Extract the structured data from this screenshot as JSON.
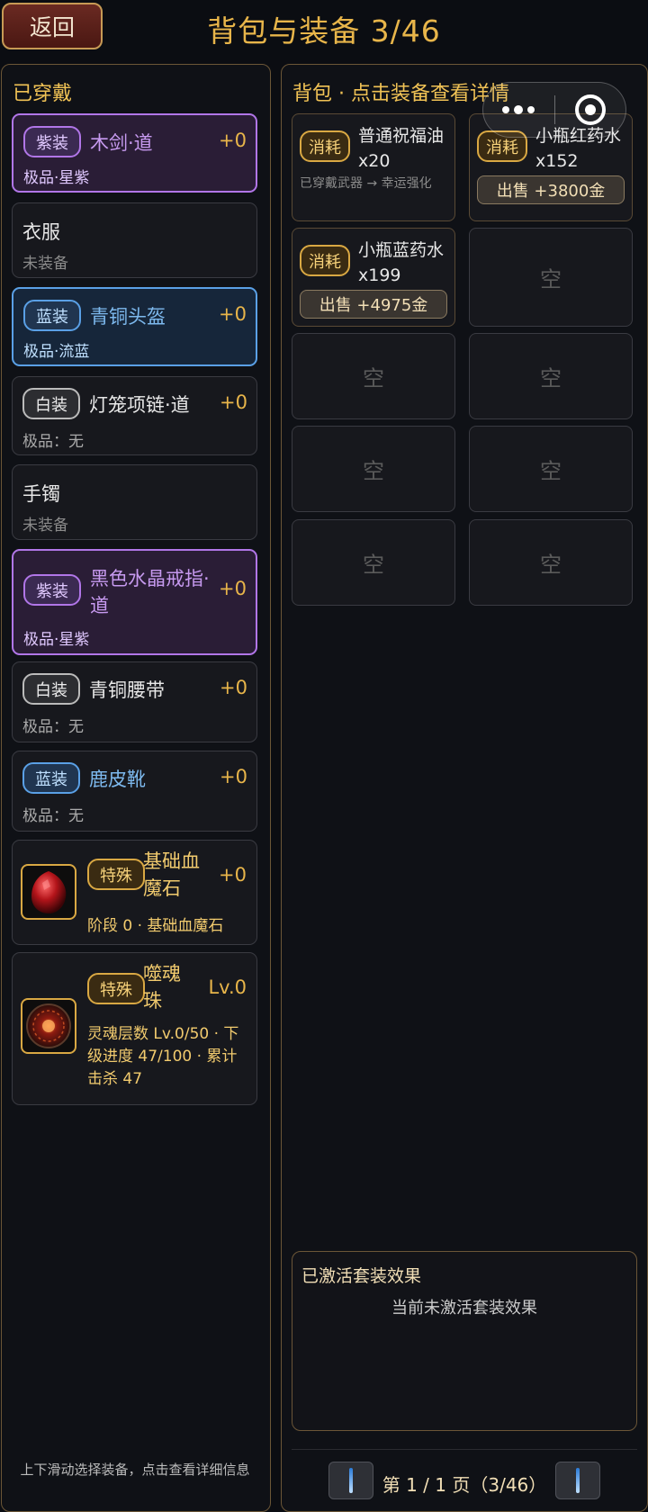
{
  "header": {
    "back_label": "返回",
    "title": "背包与装备 3/46"
  },
  "equipped": {
    "title": "已穿戴",
    "items": [
      {
        "tag": "紫装",
        "name": "木剑·道",
        "plus": "+0",
        "sub": "极品·星紫"
      },
      {
        "name": "衣服",
        "sub": "未装备"
      },
      {
        "tag": "蓝装",
        "name": "青铜头盔",
        "plus": "+0",
        "sub": "极品·流蓝"
      },
      {
        "tag": "白装",
        "name": "灯笼项链·道",
        "plus": "+0",
        "sub": "极品：无"
      },
      {
        "name": "手镯",
        "sub": "未装备"
      },
      {
        "tag": "紫装",
        "name": "黑色水晶戒指·道",
        "plus": "+0",
        "sub": "极品·星紫"
      },
      {
        "tag": "白装",
        "name": "青铜腰带",
        "plus": "+0",
        "sub": "极品：无"
      },
      {
        "tag": "蓝装",
        "name": "鹿皮靴",
        "plus": "+0",
        "sub": "极品：无"
      },
      {
        "tag": "特殊",
        "name": "基础血魔石",
        "plus": "+0",
        "sub": "阶段 0 · 基础血魔石",
        "icon": "blood-stone-icon"
      },
      {
        "tag": "特殊",
        "name": "噬魂珠",
        "plus": "Lv.0",
        "sub": "灵魂层数 Lv.0/50 · 下级进度 47/100 · 累计击杀 47",
        "icon": "soul-orb-icon"
      }
    ],
    "hint": "上下滑动选择装备，点击查看详细信息"
  },
  "bag": {
    "title": "背包 · 点击装备查看详情",
    "slots": [
      {
        "tag": "消耗",
        "name": "普通祝福油 x20",
        "note": "已穿戴武器 → 幸运强化"
      },
      {
        "tag": "消耗",
        "name": "小瓶红药水 x152",
        "sell": "出售 +3800金"
      },
      {
        "tag": "消耗",
        "name": "小瓶蓝药水 x199",
        "sell": "出售 +4975金"
      },
      {
        "empty": "空"
      },
      {
        "empty": "空"
      },
      {
        "empty": "空"
      },
      {
        "empty": "空"
      },
      {
        "empty": "空"
      },
      {
        "empty": "空"
      },
      {
        "empty": "空"
      }
    ]
  },
  "set_effects": {
    "title": "已激活套装效果",
    "empty": "当前未激活套装效果"
  },
  "pager": {
    "text": "第 1 / 1 页（3/46）"
  },
  "capsule": {
    "menu_icon": "more-dots-icon",
    "close_icon": "target-close-icon"
  }
}
